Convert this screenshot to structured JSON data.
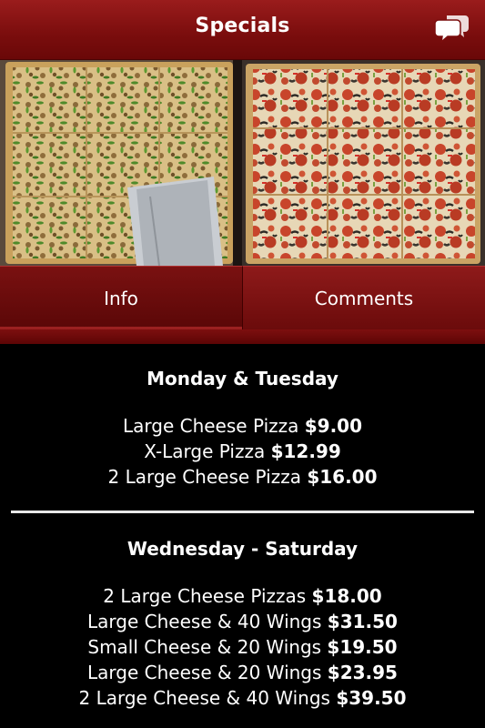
{
  "header": {
    "title": "Specials",
    "chat_icon": "speech-bubbles-icon"
  },
  "hero_image": {
    "description_icon": "pizza-photo"
  },
  "tabs": [
    {
      "label": "Info"
    },
    {
      "label": "Comments"
    }
  ],
  "sections": [
    {
      "title": "Monday & Tuesday",
      "items": [
        {
          "name": "Large Cheese Pizza",
          "price": "$9.00"
        },
        {
          "name": "X-Large Pizza",
          "price": "$12.99"
        },
        {
          "name": "2 Large Cheese Pizza",
          "price": "$16.00"
        }
      ]
    },
    {
      "title": "Wednesday - Saturday",
      "items": [
        {
          "name": "2 Large Cheese Pizzas",
          "price": "$18.00"
        },
        {
          "name": "Large Cheese & 40 Wings",
          "price": "$31.50"
        },
        {
          "name": "Small Cheese & 20 Wings",
          "price": "$19.50"
        },
        {
          "name": "Large Cheese & 20 Wings",
          "price": "$23.95"
        },
        {
          "name": "2 Large Cheese & 40 Wings",
          "price": "$39.50"
        }
      ]
    }
  ],
  "colors": {
    "header_red": "#8a1414",
    "tab_red": "#7a0f0f",
    "background": "#000000",
    "text": "#ffffff"
  }
}
